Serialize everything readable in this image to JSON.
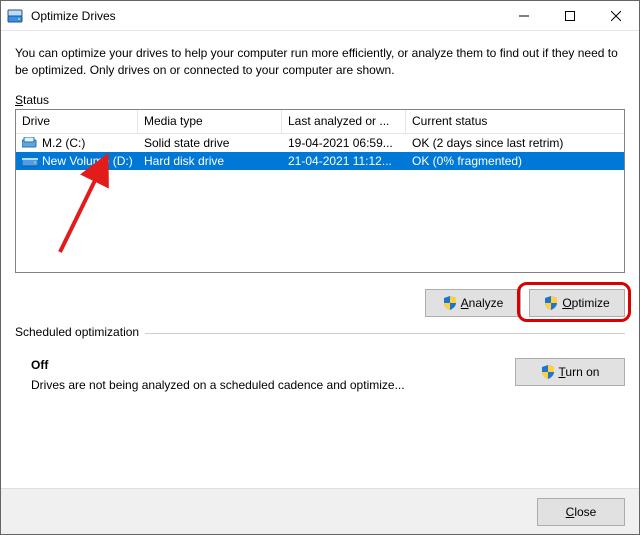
{
  "titlebar": {
    "title": "Optimize Drives"
  },
  "intro": "You can optimize your drives to help your computer run more efficiently, or analyze them to find out if they need to be optimized. Only drives on or connected to your computer are shown.",
  "status_label": {
    "u": "S",
    "rest": "tatus"
  },
  "columns": {
    "drive": "Drive",
    "media": "Media type",
    "last": "Last analyzed or ...",
    "status": "Current status"
  },
  "drives": [
    {
      "icon": "ssd",
      "name": "M.2 (C:)",
      "media": "Solid state drive",
      "last": "19-04-2021 06:59...",
      "status": "OK (2 days since last retrim)",
      "selected": false
    },
    {
      "icon": "hdd",
      "name": "New Volume (D:)",
      "media": "Hard disk drive",
      "last": "21-04-2021 11:12...",
      "status": "OK (0% fragmented)",
      "selected": true
    }
  ],
  "buttons": {
    "analyze": {
      "u": "A",
      "rest": "nalyze"
    },
    "optimize": {
      "u": "O",
      "rest": "ptimize"
    },
    "turnon": {
      "u": "T",
      "rest": "urn on"
    },
    "close": {
      "u": "C",
      "rest": "lose"
    }
  },
  "schedule": {
    "header": "Scheduled optimization",
    "state": "Off",
    "desc": "Drives are not being analyzed on a scheduled cadence and optimize..."
  }
}
